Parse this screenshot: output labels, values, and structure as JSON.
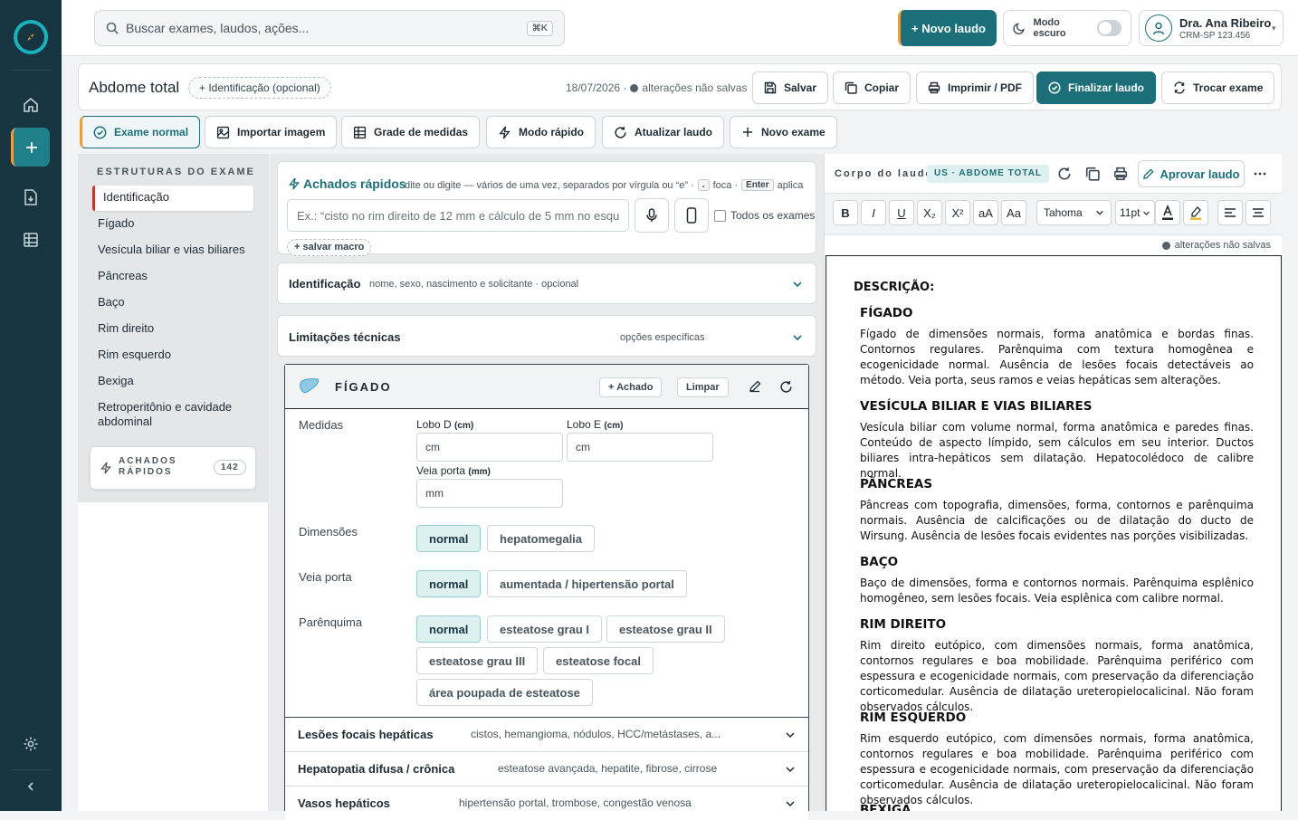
{
  "search": {
    "placeholder": "Buscar exames, laudos, ações...",
    "shortcut": "⌘K"
  },
  "header": {
    "new_report": "+ Novo laudo",
    "dark_mode": "Modo escuro",
    "user_name": "Dra. Ana Ribeiro",
    "user_crm": "CRM-SP 123.456"
  },
  "doc": {
    "title": "Abdome total",
    "id_pill": "+ Identificação (opcional)",
    "date": "18/07/2026 ·",
    "status": "alterações não salvas",
    "save": "Salvar",
    "copy": "Copiar",
    "print": "Imprimir / PDF",
    "finalize": "Finalizar laudo",
    "switch": "Trocar exame"
  },
  "toolbar": {
    "normal": "Exame normal",
    "import": "Importar imagem",
    "grid": "Grade de medidas",
    "quick": "Modo rápido",
    "update": "Atualizar laudo",
    "new": "Novo exame"
  },
  "sidebar": {
    "heading": "ESTRUTURAS DO EXAME",
    "items": [
      "Identificação",
      "Fígado",
      "Vesícula biliar e vias biliares",
      "Pâncreas",
      "Baço",
      "Rim direito",
      "Rim esquerdo",
      "Bexiga",
      "Retroperitônio e cavidade abdominal"
    ],
    "quick_label": "ACHADOS RÁPIDOS",
    "quick_count": "142"
  },
  "quick": {
    "title": "Achados rápidos",
    "help_a": "dite ou digite — vários de uma vez, separados por vírgula ou “e” ·",
    "help_key1": ".",
    "help_b": "foca ·",
    "help_key2": "Enter",
    "help_c": "aplica",
    "placeholder": "Ex.: “cisto no rim direito de 12 mm e cálculo de 5 mm no esquerdo”",
    "all_exams": "Todos os exames",
    "save_macro": "+ salvar macro"
  },
  "acc_id": {
    "title": "Identificação",
    "sub": "nome, sexo, nascimento e solicitante · opcional"
  },
  "acc_lim": {
    "title": "Limitações técnicas",
    "sub": "opções específicas"
  },
  "figado": {
    "title": "FÍGADO",
    "add": "+ Achado",
    "clear": "Limpar",
    "measures": "Medidas",
    "lobo_d": "Lobo D",
    "lobo_e": "Lobo E",
    "veia_porta_m": "Veia porta",
    "unit_cm": "(cm)",
    "unit_mm": "(mm)",
    "ph_cm": "cm",
    "ph_mm": "mm",
    "dim_label": "Dimensões",
    "dim_opts": [
      "normal",
      "hepatomegalia"
    ],
    "vp_label": "Veia porta",
    "vp_opts": [
      "normal",
      "aumentada / hipertensão portal"
    ],
    "par_label": "Parênquima",
    "par_opts": [
      "normal",
      "esteatose grau I",
      "esteatose grau II",
      "esteatose grau III",
      "esteatose focal",
      "área poupada de esteatose"
    ],
    "sub1_t": "Lesões focais hepáticas",
    "sub1_s": "cistos, hemangioma, nódulos, HCC/metástases, a...",
    "sub2_t": "Hepatopatia difusa / crônica",
    "sub2_s": "esteatose avançada, hepatite, fibrose, cirrose",
    "sub3_t": "Vasos hepáticos",
    "sub3_s": "hipertensão portal, trombose, congestão venosa"
  },
  "editor": {
    "title": "Corpo do laudo",
    "tag": "US · ABDOME TOTAL",
    "approve": "Aprovar laudo",
    "font": "Tahoma",
    "size": "11pt",
    "unsaved": "alterações não salvas",
    "fmt": {
      "bold": "B",
      "italic": "I",
      "underline": "U",
      "sub": "X₂",
      "sup": "X²",
      "upper": "aA",
      "case": "Aa"
    },
    "desc": "DESCRIÇÃO:",
    "sections": [
      {
        "h": "FÍGADO",
        "p": "Fígado de dimensões normais, forma anatômica e bordas finas. Contornos regulares. Parênquima com textura homogênea e ecogenicidade normal. Ausência de lesões focais detectáveis ao método. Veia porta, seus ramos e veias hepáticas sem alterações."
      },
      {
        "h": "VESÍCULA BILIAR E VIAS BILIARES",
        "p": "Vesícula biliar com volume normal, forma anatômica e paredes finas. Conteúdo de aspecto límpido, sem cálculos em seu interior. Ductos biliares intra-hepáticos sem dilatação. Hepatocolédoco de calibre normal."
      },
      {
        "h": "PÂNCREAS",
        "p": "Pâncreas com topografia, dimensões, forma, contornos e parênquima normais. Ausência de calcificações ou de dilatação do ducto de Wirsung. Ausência de lesões focais evidentes nas porções visibilizadas."
      },
      {
        "h": "BAÇO",
        "p": "Baço de dimensões, forma e contornos normais. Parênquima esplênico homogêneo, sem lesões focais. Veia esplênica com calibre normal."
      },
      {
        "h": "RIM DIREITO",
        "p": "Rim direito eutópico, com dimensões normais, forma anatômica, contornos regulares e boa mobilidade. Parênquima periférico com espessura e ecogenicidade normais, com preservação da diferenciação corticomedular. Ausência de dilatação ureteropielocalicinal. Não foram observados cálculos."
      },
      {
        "h": "RIM ESQUERDO",
        "p": "Rim esquerdo eutópico, com dimensões normais, forma anatômica, contornos regulares e boa mobilidade. Parênquima periférico com espessura e ecogenicidade normais, com preservação da diferenciação corticomedular. Ausência de dilatação ureteropielocalicinal. Não foram observados cálculos."
      },
      {
        "h": "BEXIGA",
        "p": ""
      }
    ]
  }
}
